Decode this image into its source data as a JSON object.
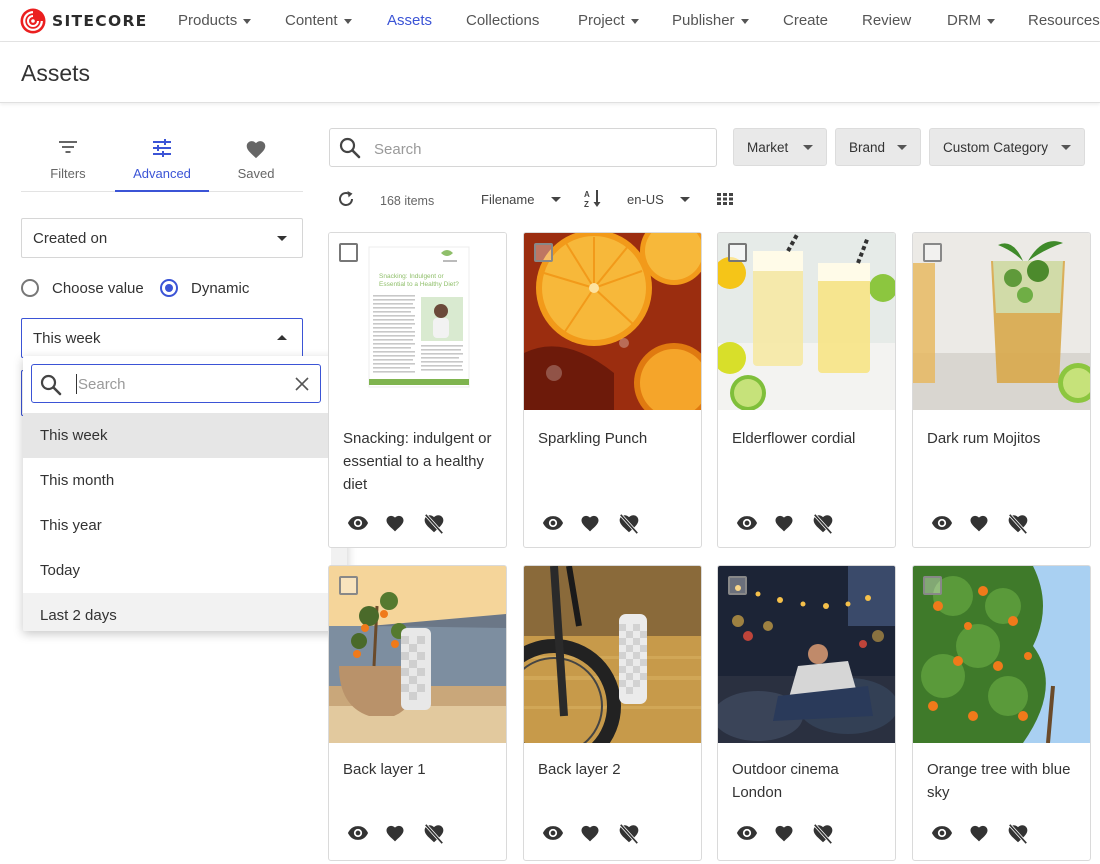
{
  "brand": {
    "name": "SITECORE",
    "accent": "#eb1f1f",
    "primary": "#3b54d6"
  },
  "nav": [
    {
      "label": "Products",
      "dropdown": true
    },
    {
      "label": "Content",
      "dropdown": true
    },
    {
      "label": "Assets",
      "dropdown": false,
      "active": true
    },
    {
      "label": "Collections",
      "dropdown": false
    },
    {
      "label": "Project",
      "dropdown": true
    },
    {
      "label": "Publisher",
      "dropdown": true
    },
    {
      "label": "Create",
      "dropdown": false
    },
    {
      "label": "Review",
      "dropdown": false
    },
    {
      "label": "DRM",
      "dropdown": true
    },
    {
      "label": "Resources",
      "dropdown": false
    }
  ],
  "page": {
    "title": "Assets"
  },
  "left_tabs": [
    {
      "label": "Filters",
      "icon": "filter-icon"
    },
    {
      "label": "Advanced",
      "icon": "tune-icon",
      "active": true
    },
    {
      "label": "Saved",
      "icon": "heart-icon"
    }
  ],
  "advanced": {
    "field_select": "Created on",
    "radio_choose": "Choose value",
    "radio_dynamic": "Dynamic",
    "radio_selected": "Dynamic",
    "range_select": "This week",
    "dropdown_search_placeholder": "Search",
    "dropdown_options": [
      "This week",
      "This month",
      "This year",
      "Today",
      "Last 2 days"
    ],
    "dropdown_selected": "This week"
  },
  "main": {
    "search_placeholder": "Search",
    "filters": [
      "Market",
      "Brand",
      "Custom Category"
    ],
    "item_count": "168 items",
    "sort_field": "Filename",
    "locale": "en-US"
  },
  "assets": [
    {
      "title": "Snacking: indulgent or essential to a healthy diet"
    },
    {
      "title": "Sparkling Punch"
    },
    {
      "title": "Elderflower cordial"
    },
    {
      "title": "Dark rum Mojitos"
    },
    {
      "title": "Back layer 1"
    },
    {
      "title": "Back layer 2"
    },
    {
      "title": "Outdoor cinema London"
    },
    {
      "title": "Orange tree with blue sky"
    }
  ],
  "doc_thumb": {
    "heading": "Snacking: Indulgent or Essential to a Healthy Diet?"
  }
}
